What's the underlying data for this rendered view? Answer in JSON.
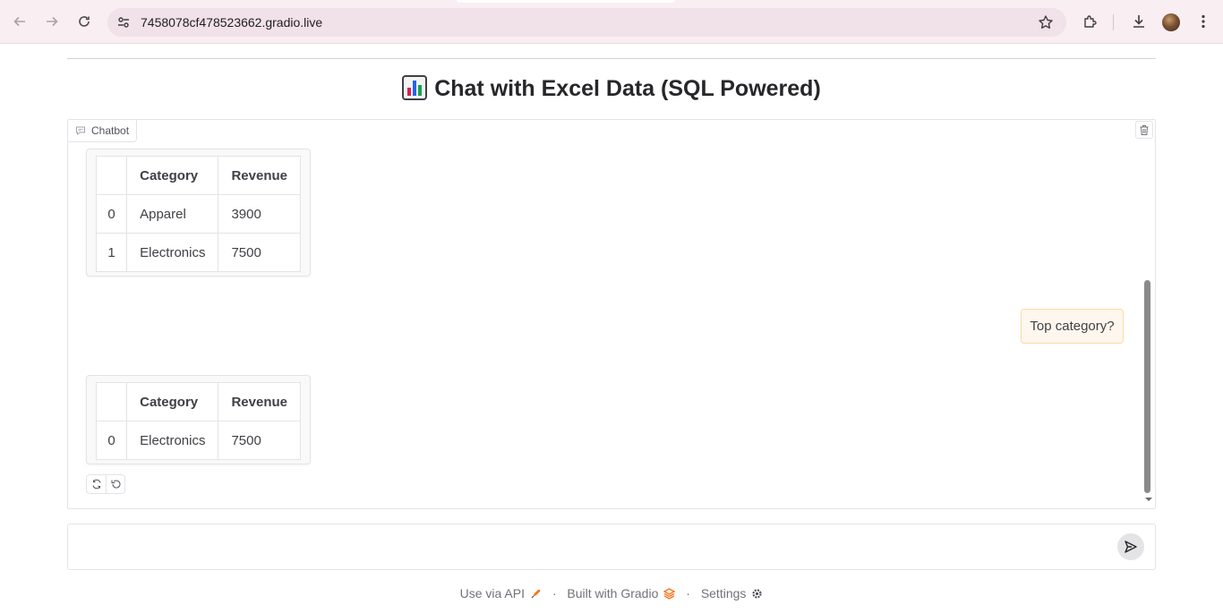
{
  "browser": {
    "url": "7458078cf478523662.gradio.live"
  },
  "page": {
    "title": "Chat with Excel Data (SQL Powered)",
    "title_icon": "bar-chart-emoji"
  },
  "chatbot": {
    "label": "Chatbot",
    "messages": [
      {
        "role": "bot",
        "table": {
          "headers": [
            "",
            "Category",
            "Revenue"
          ],
          "rows": [
            [
              "0",
              "Apparel",
              "3900"
            ],
            [
              "1",
              "Electronics",
              "7500"
            ]
          ]
        }
      },
      {
        "role": "user",
        "text": "Top category?"
      },
      {
        "role": "bot",
        "table": {
          "headers": [
            "",
            "Category",
            "Revenue"
          ],
          "rows": [
            [
              "0",
              "Electronics",
              "7500"
            ]
          ]
        }
      }
    ]
  },
  "input": {
    "value": "",
    "placeholder": ""
  },
  "footer": {
    "api": "Use via API",
    "built": "Built with Gradio",
    "settings": "Settings",
    "separator": "·"
  },
  "colors": {
    "accent": "#f97316",
    "user_bubble": "#fff7ed"
  }
}
